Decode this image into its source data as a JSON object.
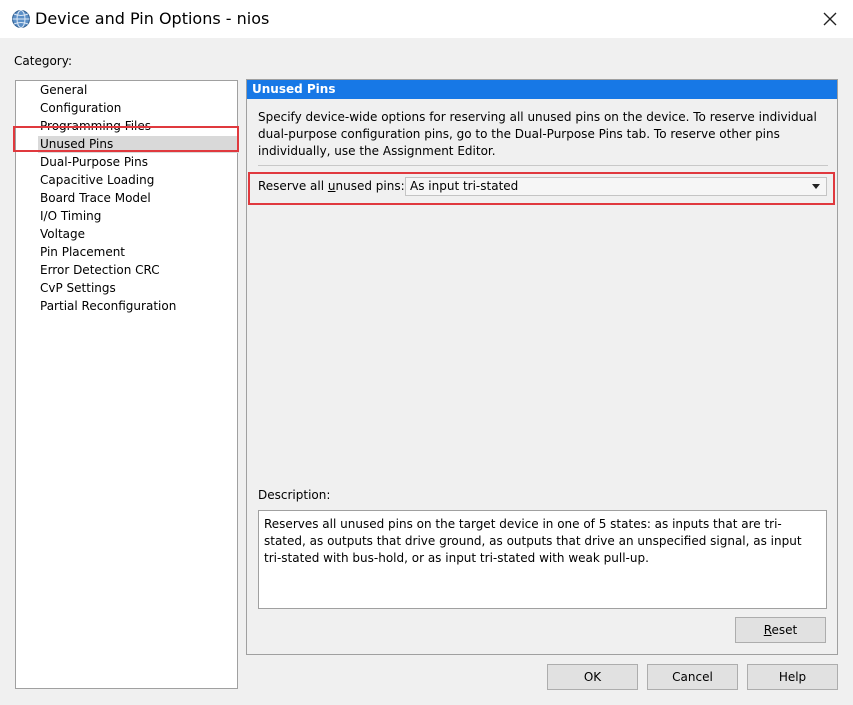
{
  "window": {
    "title": "Device and Pin Options - nios",
    "icon": "quartus-globe-icon"
  },
  "category": {
    "label": "Category:",
    "items": [
      {
        "label": "General"
      },
      {
        "label": "Configuration"
      },
      {
        "label": "Programming Files"
      },
      {
        "label": "Unused Pins",
        "selected": true
      },
      {
        "label": "Dual-Purpose Pins"
      },
      {
        "label": "Capacitive Loading"
      },
      {
        "label": "Board Trace Model"
      },
      {
        "label": "I/O Timing"
      },
      {
        "label": "Voltage"
      },
      {
        "label": "Pin Placement"
      },
      {
        "label": "Error Detection CRC"
      },
      {
        "label": "CvP Settings"
      },
      {
        "label": "Partial Reconfiguration"
      }
    ]
  },
  "panel": {
    "header": "Unused Pins",
    "intro": "Specify device-wide options for reserving all unused pins on the device. To reserve individual dual-purpose configuration pins, go to the Dual-Purpose Pins tab. To reserve other pins individually, use the Assignment Editor.",
    "reserve_label_pre": "Reserve all ",
    "reserve_label_u": "u",
    "reserve_label_post": "nused pins:",
    "reserve_value": "As input tri-stated",
    "description_label": "Description:",
    "description_text": "Reserves all unused pins on the target device in one of 5 states: as inputs that are tri-stated, as outputs that drive ground, as outputs that drive an unspecified signal, as input tri-stated with bus-hold, or as input tri-stated with weak pull-up.",
    "reset_u": "R",
    "reset_rest": "eset"
  },
  "buttons": {
    "ok": "OK",
    "cancel": "Cancel",
    "help": "Help"
  },
  "colors": {
    "header_blue": "#1778e6",
    "highlight_red": "#e0393e",
    "selection_gray": "#d9d9d9"
  }
}
